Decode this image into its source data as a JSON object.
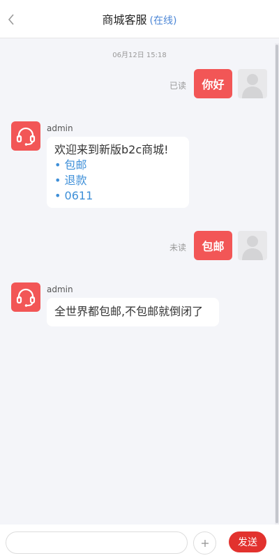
{
  "header": {
    "title": "商城客服",
    "status": "(在线)",
    "back_icon": "chevron-left-icon"
  },
  "chat": {
    "timestamp": "06月12日 15:18",
    "messages": [
      {
        "direction": "out",
        "text": "你好",
        "read_status": "已读",
        "avatar_icon": "user-silhouette-icon"
      },
      {
        "direction": "in",
        "sender": "admin",
        "text": "欢迎来到新版b2c商城!",
        "links": [
          "• 包邮",
          "• 退款",
          "• 0611"
        ],
        "avatar_icon": "headset-icon"
      },
      {
        "direction": "out",
        "text": "包邮",
        "read_status": "未读",
        "avatar_icon": "user-silhouette-icon"
      },
      {
        "direction": "in",
        "sender": "admin",
        "text": "全世界都包邮,不包邮就倒闭了",
        "avatar_icon": "headset-icon"
      }
    ]
  },
  "footer": {
    "input_value": "",
    "input_placeholder": "",
    "plus_icon": "plus-icon",
    "send_label": "发送"
  },
  "colors": {
    "accent": "#f25656",
    "send_button": "#e2322e",
    "link": "#3e8fd8",
    "status": "#4b86d6",
    "background": "#f4f5f9"
  }
}
